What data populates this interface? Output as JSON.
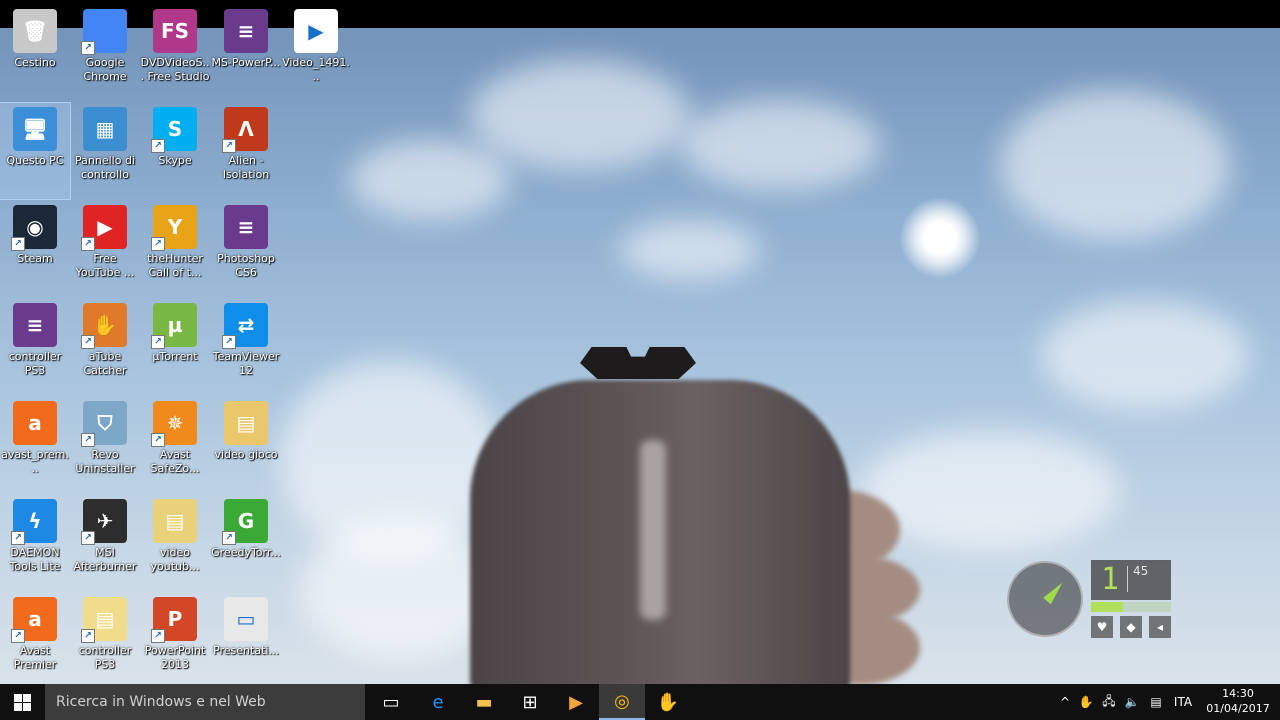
{
  "desktop_icons": [
    {
      "label": "Cestino",
      "glyph": "🗑",
      "color": "#c8c8c8",
      "shortcut": false
    },
    {
      "label": "Google Chrome",
      "glyph": "",
      "color": "#4285f4",
      "shortcut": true
    },
    {
      "label": "DVDVideoS... Free Studio",
      "glyph": "FS",
      "color": "#b0378a",
      "shortcut": false
    },
    {
      "label": "MS-PowerP...",
      "glyph": "≡",
      "color": "#6a3a8c",
      "shortcut": false
    },
    {
      "label": "Video_1491...",
      "glyph": "▶",
      "color": "#ffffff",
      "shortcut": false
    },
    {
      "label": "Questo PC",
      "glyph": "🖥",
      "color": "#3a8fd8",
      "shortcut": false,
      "selected": true
    },
    {
      "label": "Pannello di controllo",
      "glyph": "▦",
      "color": "#3b8ed0",
      "shortcut": false
    },
    {
      "label": "Skype",
      "glyph": "S",
      "color": "#00aff0",
      "shortcut": true
    },
    {
      "label": "Alien - Isolation",
      "glyph": "Ʌ",
      "color": "#c0391b",
      "shortcut": true
    },
    {
      "label": "Steam",
      "glyph": "◉",
      "color": "#1b2838",
      "shortcut": true
    },
    {
      "label": "Free YouTube ...",
      "glyph": "▶",
      "color": "#e02424",
      "shortcut": true
    },
    {
      "label": "theHunter Call of t...",
      "glyph": "Y",
      "color": "#e8a317",
      "shortcut": true
    },
    {
      "label": "Photoshop CS6",
      "glyph": "≡",
      "color": "#6a3a8c",
      "shortcut": false
    },
    {
      "label": "controller PS3",
      "glyph": "≡",
      "color": "#6a3a8c",
      "shortcut": false
    },
    {
      "label": "aTube Catcher",
      "glyph": "✋",
      "color": "#e07a2a",
      "shortcut": true
    },
    {
      "label": "µTorrent",
      "glyph": "µ",
      "color": "#78b843",
      "shortcut": true
    },
    {
      "label": "TeamViewer 12",
      "glyph": "⇄",
      "color": "#0e8ee9",
      "shortcut": true
    },
    {
      "label": "avast_prem...",
      "glyph": "a",
      "color": "#f26b1d",
      "shortcut": false
    },
    {
      "label": "Revo Uninstaller",
      "glyph": "⛉",
      "color": "#7da7c9",
      "shortcut": true
    },
    {
      "label": "Avast SafeZo...",
      "glyph": "✵",
      "color": "#f08a1d",
      "shortcut": true
    },
    {
      "label": "video gioco",
      "glyph": "▤",
      "color": "#e9c76a",
      "shortcut": false
    },
    {
      "label": "DAEMON Tools Lite",
      "glyph": "ϟ",
      "color": "#1e88e5",
      "shortcut": true
    },
    {
      "label": "MSI Afterburner",
      "glyph": "✈",
      "color": "#2d2d2d",
      "shortcut": true
    },
    {
      "label": "video youtub...",
      "glyph": "▤",
      "color": "#e9d27a",
      "shortcut": false
    },
    {
      "label": "GreedyTorr...",
      "glyph": "G",
      "color": "#3aa935",
      "shortcut": true
    },
    {
      "label": "Avast Premier",
      "glyph": "a",
      "color": "#f26b1d",
      "shortcut": true
    },
    {
      "label": "controller PS3",
      "glyph": "▤",
      "color": "#f0dc8a",
      "shortcut": true
    },
    {
      "label": "PowerPoint 2013",
      "glyph": "P",
      "color": "#d24726",
      "shortcut": true
    },
    {
      "label": "Presentati...",
      "glyph": "▭",
      "color": "#e8e8e8",
      "shortcut": false
    }
  ],
  "hud": {
    "magazine": "1",
    "reserve": "45",
    "bar_level": 0.4,
    "needle_color": "#9fdc4a"
  },
  "taskbar": {
    "search_placeholder": "Ricerca in Windows e nel Web",
    "apps": [
      {
        "name": "task-view",
        "glyph": "▭",
        "active": false
      },
      {
        "name": "edge",
        "glyph": "e",
        "active": false
      },
      {
        "name": "file-explorer",
        "glyph": "▬",
        "active": false
      },
      {
        "name": "store",
        "glyph": "⊞",
        "active": false
      },
      {
        "name": "media-player",
        "glyph": "▶",
        "active": false
      },
      {
        "name": "chrome",
        "glyph": "◎",
        "active": true
      },
      {
        "name": "atube-catcher",
        "glyph": "✋",
        "active": false
      }
    ],
    "tray": {
      "language": "ITA",
      "time": "14:30",
      "date": "01/04/2017"
    }
  },
  "colors": {
    "taskbar": "#101010",
    "search_box": "#3c3c3c",
    "accent": "#8fb6e6"
  }
}
